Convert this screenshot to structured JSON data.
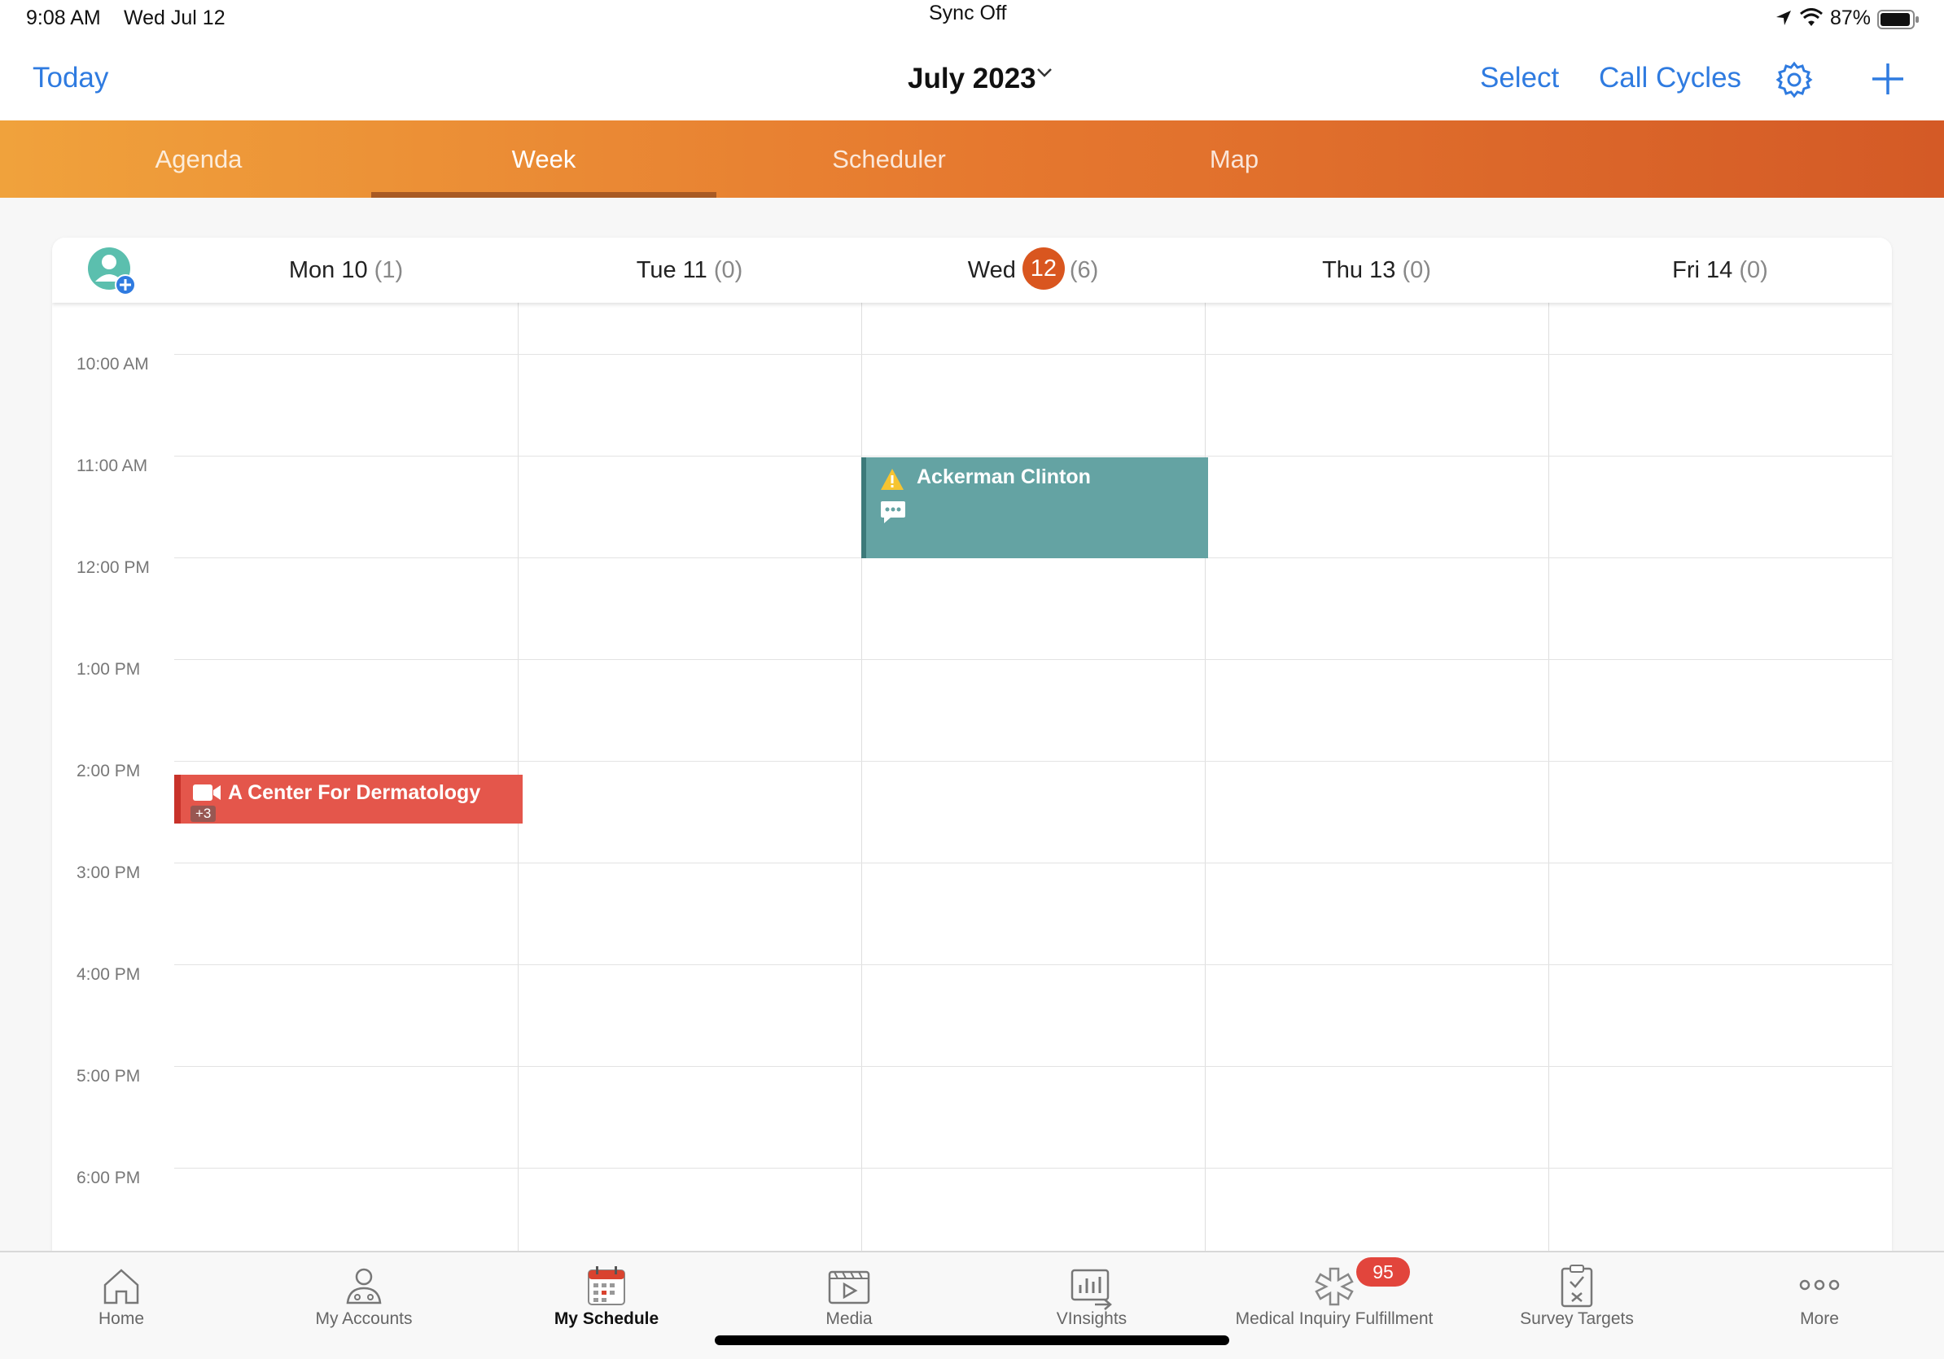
{
  "status_bar": {
    "time": "9:08 AM",
    "date": "Wed Jul 12",
    "sync_status": "Sync Off",
    "battery": "87%",
    "icons": [
      "location-arrow-icon",
      "wifi-icon",
      "battery-icon"
    ]
  },
  "nav": {
    "today_label": "Today",
    "month_title": "July 2023",
    "select_label": "Select",
    "call_cycles_label": "Call Cycles",
    "icons": [
      "chevron-down-icon",
      "gear-icon",
      "plus-icon"
    ],
    "accent_color": "#2f7be0"
  },
  "tabs": {
    "items": [
      {
        "label": "Agenda"
      },
      {
        "label": "Week"
      },
      {
        "label": "Scheduler"
      },
      {
        "label": "Map"
      }
    ],
    "active": "Week",
    "gradient_colors": [
      "#f0a23c",
      "#d45a26"
    ]
  },
  "week": {
    "days": [
      {
        "label": "Mon 10",
        "count": "(1)"
      },
      {
        "label": "Tue 11",
        "count": "(0)"
      },
      {
        "prefix": "Wed",
        "badge": "12",
        "count": "(6)"
      },
      {
        "label": "Thu 13",
        "count": "(0)"
      },
      {
        "label": "Fri 14",
        "count": "(0)"
      }
    ],
    "today_color": "#d9561f",
    "time_labels": [
      "10:00 AM",
      "11:00 AM",
      "12:00 PM",
      "1:00 PM",
      "2:00 PM",
      "3:00 PM",
      "4:00 PM",
      "5:00 PM",
      "6:00 PM"
    ]
  },
  "events": {
    "ackerman": {
      "title": "Ackerman Clinton",
      "day": "Wed 12",
      "slot": "11:00 AM - 12:00 PM",
      "icons": [
        "warning-icon",
        "chat-bubble-icon"
      ],
      "color": "#64a3a3"
    },
    "dermatology": {
      "title": "A Center For Dermatology",
      "extra": "+3",
      "day": "Mon 10",
      "slot": "2:00 PM",
      "icons": [
        "video-camera-icon"
      ],
      "color": "#e4564b"
    }
  },
  "bottom_tabs": {
    "items": [
      {
        "label": "Home",
        "icon": "home-icon"
      },
      {
        "label": "My Accounts",
        "icon": "person-icon"
      },
      {
        "label": "My Schedule",
        "icon": "calendar-icon"
      },
      {
        "label": "Media",
        "icon": "media-icon"
      },
      {
        "label": "VInsights",
        "icon": "insights-chart-icon"
      },
      {
        "label": "Medical Inquiry Fulfillment",
        "icon": "medical-star-icon"
      },
      {
        "label": "Survey Targets",
        "icon": "clipboard-check-icon"
      },
      {
        "label": "More",
        "icon": "more-dots-icon"
      }
    ],
    "active": "My Schedule",
    "medical_badge": "95",
    "badge_color": "#e2453c"
  }
}
